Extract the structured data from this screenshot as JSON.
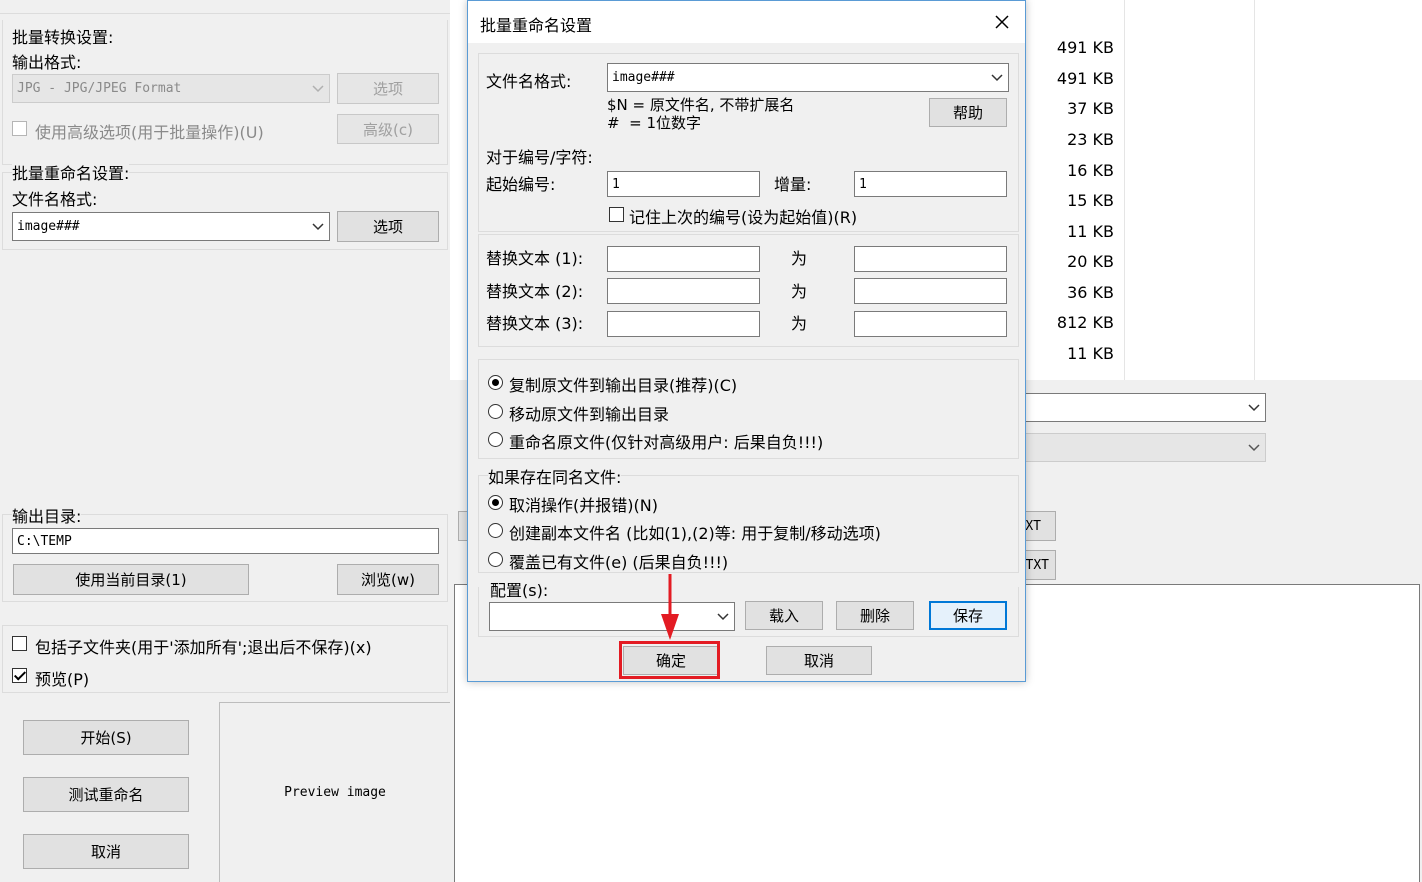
{
  "left_panel": {
    "batch_section_title": "批量转换设置:",
    "output_format_label": "输出格式:",
    "output_format_value": "JPG - JPG/JPEG Format",
    "options_button": "选项",
    "use_advanced_label": "使用高级选项(用于批量操作)(U)",
    "advanced_button": "高级(c)",
    "rename_section_title": "批量重命名设置:",
    "filename_format_label": "文件名格式:",
    "filename_format_value": "image###",
    "rename_options_button": "选项",
    "output_dir_label": "输出目录:",
    "output_dir_value": "C:\\TEMP",
    "use_current_dir_button": "使用当前目录(1)",
    "browse_button": "浏览(w)",
    "include_subfolders_label": "包括子文件夹(用于'添加所有';退出后不保存)(x)",
    "include_subfolders_checked": false,
    "preview_label": "预览(P)",
    "preview_checked": true,
    "start_button": "开始(S)",
    "test_rename_button": "测试重命名",
    "cancel_button": "取消",
    "preview_image_text": "Preview image"
  },
  "file_sizes": [
    "491 KB",
    "491 KB",
    "37 KB",
    "23 KB",
    "16 KB",
    "15 KB",
    "11 KB",
    "20 KB",
    "36 KB",
    "812 KB",
    "11 KB"
  ],
  "right_partial": {
    "button_a": "XT",
    "button_b": "TXT"
  },
  "dialog": {
    "title": "批量重命名设置",
    "filename_format_label": "文件名格式:",
    "filename_format_value": "image###",
    "hint_line1": "$N = 原文件名, 不带扩展名",
    "hint_line2": "#  = 1位数字",
    "help_button": "帮助",
    "numbering_label": "对于编号/字符:",
    "start_number_label": "起始编号:",
    "start_number_value": "1",
    "increment_label": "增量:",
    "increment_value": "1",
    "remember_label": "记住上次的编号(设为起始值)(R)",
    "remember_checked": false,
    "replace1_label": "替换文本 (1):",
    "replace2_label": "替换文本 (2):",
    "replace3_label": "替换文本 (3):",
    "replace_with": "为",
    "mode_copy": "复制原文件到输出目录(推荐)(C)",
    "mode_move": "移动原文件到输出目录",
    "mode_rename": "重命名原文件(仅针对高级用户: 后果自负!!!)",
    "exists_label": "如果存在同名文件:",
    "exists_cancel": "取消操作(并报错)(N)",
    "exists_copy": "创建副本文件名 (比如(1),(2)等: 用于复制/移动选项)",
    "exists_overwrite": "覆盖已有文件(e) (后果自负!!!)",
    "config_label": "配置(s):",
    "load_button": "载入",
    "delete_button": "删除",
    "save_button": "保存",
    "ok_button": "确定",
    "cancel_button": "取消"
  },
  "highlight_color": "#e31b23",
  "accent_color": "#0078d7"
}
